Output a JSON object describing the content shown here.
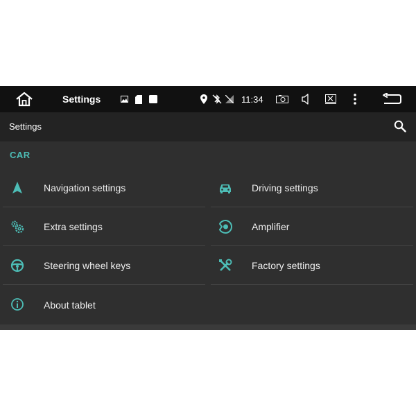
{
  "status_bar": {
    "app_title": "Settings",
    "time": "11:34"
  },
  "app_bar": {
    "title": "Settings"
  },
  "section": {
    "header": "CAR"
  },
  "items": [
    {
      "label": "Navigation settings"
    },
    {
      "label": "Driving settings"
    },
    {
      "label": "Extra settings"
    },
    {
      "label": "Amplifier"
    },
    {
      "label": "Steering wheel keys"
    },
    {
      "label": "Factory settings"
    },
    {
      "label": "About tablet"
    }
  ],
  "colors": {
    "accent": "#4dbdb6",
    "background": "#2f2f2f",
    "status_bar": "#111111",
    "app_bar": "#232323"
  },
  "icons": {
    "home": "home-icon",
    "search": "search-icon",
    "back": "back-icon",
    "more": "more-vert-icon"
  }
}
